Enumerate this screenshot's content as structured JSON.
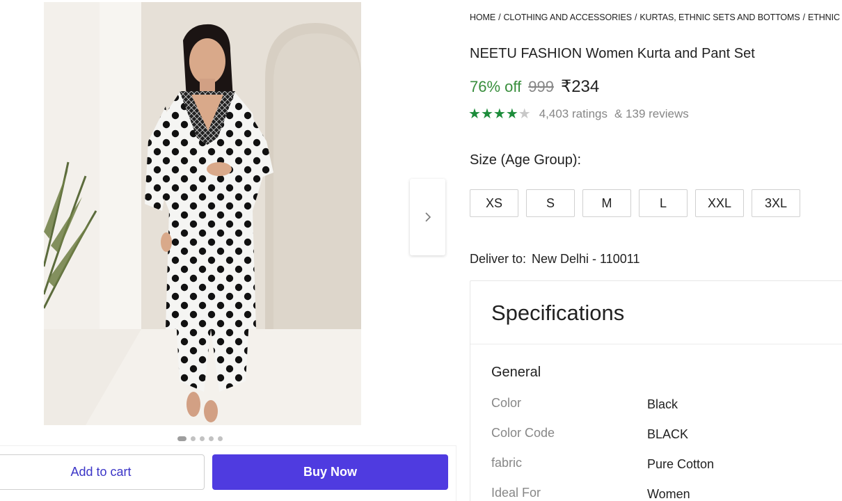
{
  "breadcrumb": [
    "HOME",
    "CLOTHING AND ACCESSORIES",
    "KURTAS, ETHNIC SETS AND BOTTOMS",
    "ETHNIC"
  ],
  "product": {
    "title": "NEETU FASHION Women Kurta and Pant Set",
    "discount": "76% off",
    "mrp": "999",
    "price": "₹234",
    "rating_stars": 4,
    "ratings_text": "4,403 ratings",
    "reviews_text": "& 139 reviews"
  },
  "gallery": {
    "dots_total": 5,
    "active_dot": 1
  },
  "sizes": {
    "label": "Size (Age Group):",
    "options": [
      "XS",
      "S",
      "M",
      "L",
      "XXL",
      "3XL"
    ]
  },
  "delivery": {
    "label": "Deliver to:",
    "location": "New Delhi - 110011"
  },
  "specifications": {
    "title": "Specifications",
    "group": "General",
    "rows": [
      {
        "key": "Color",
        "value": "Black"
      },
      {
        "key": "Color Code",
        "value": "BLACK"
      },
      {
        "key": "fabric",
        "value": "Pure Cotton"
      },
      {
        "key": "Ideal For",
        "value": "Women"
      }
    ]
  },
  "actions": {
    "add_to_cart": "Add to cart",
    "buy_now": "Buy Now"
  },
  "colors": {
    "discount_green": "#388e3c",
    "star_green": "#1c8c3a",
    "buy_button": "#4f3be0",
    "cart_text": "#3b35c7"
  },
  "icons": {
    "next_image": "chevron-right-icon"
  }
}
